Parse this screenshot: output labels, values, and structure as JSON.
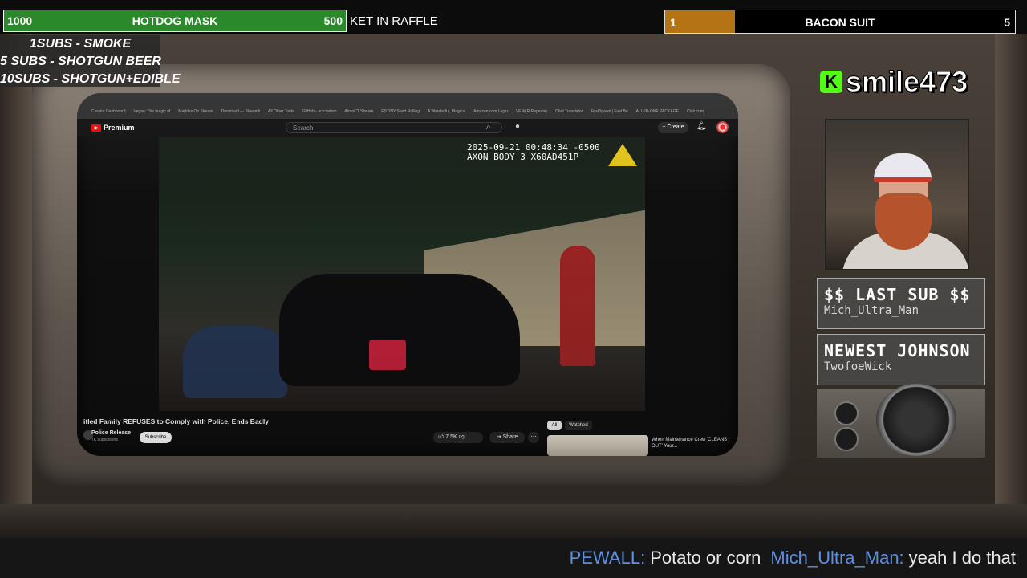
{
  "goals": {
    "left": {
      "start": "1000",
      "label": "HOTDOG MASK",
      "end": "500"
    },
    "ticker": "KET IN RAFFLE",
    "right": {
      "start": "1",
      "label": "BACON SUIT",
      "end": "5",
      "progress": 0.2
    }
  },
  "sub_menu": {
    "line1": "1SUBS   - SMOKE",
    "line2": "5 SUBS  - SHOTGUN BEER",
    "line3": "10SUBS - SHOTGUN+EDIBLE"
  },
  "streamer": {
    "logo_letter": "K",
    "name": "smile473"
  },
  "last_sub": {
    "title": "$$ LAST SUB $$",
    "value": "Mich_Ultra_Man"
  },
  "newest_follower": {
    "title": "NEWEST JOHNSON",
    "value": "TwofoeWick"
  },
  "chat": [
    {
      "user": "PEWALL:",
      "message": "Potato or corn"
    },
    {
      "user": "Mich_Ultra_Man:",
      "message": "yeah I do that"
    }
  ],
  "browser": {
    "bookmarks": [
      "Creator Dashboard",
      "Vegan: The magic of",
      "Marbles On Stream",
      "Download — Streamli",
      "All Other Tools",
      "GitHub - ac-custom",
      "AtmoCT Stream",
      "ESTINY Send Rolling",
      "A Wonderful, Magical",
      "Amazon.com Login",
      "VENKR Repeater",
      "Chat Translator",
      "FirstSpawn | Fuel Bo",
      "ALL-IN-ONE PACKAGE",
      "Club.com"
    ]
  },
  "youtube": {
    "logo": "Premium",
    "search_placeholder": "Search",
    "create_label": "+ Create",
    "video": {
      "timestamp_line1": "2025-09-21 00:48:34 -0500",
      "timestamp_line2": "AXON BODY 3 X60AD451P"
    },
    "title": "itled Family REFUSES to Comply with Police, Ends Badly",
    "channel": "Police Release",
    "subscribers": "7K subscribers",
    "subscribe_label": "Subscribe",
    "likes": "7.5K",
    "share_label": "Share",
    "chips": [
      "All",
      "Watched"
    ],
    "rec_title": "When Maintenance Crew 'CLEANS OUT' Your..."
  },
  "colors": {
    "goal_green": "#2a8a2a",
    "goal_orange": "#b57414",
    "chat_user": "#5f8fe0",
    "kick_green": "#53fc18"
  }
}
